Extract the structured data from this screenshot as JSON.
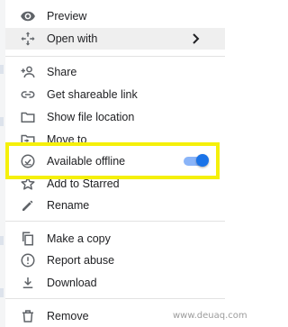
{
  "menu": {
    "items": [
      {
        "label": "Preview",
        "icon": "eye-icon"
      },
      {
        "label": "Open with",
        "icon": "move-arrows-icon",
        "submenu_indicator": "chevron-right-icon"
      },
      {
        "label": "Share",
        "icon": "person-add-icon"
      },
      {
        "label": "Get shareable link",
        "icon": "link-icon"
      },
      {
        "label": "Show file location",
        "icon": "folder-icon"
      },
      {
        "label": "Move to",
        "icon": "folder-move-icon"
      },
      {
        "label": "Available offline",
        "icon": "offline-check-icon",
        "toggle": true
      },
      {
        "label": "Add to Starred",
        "icon": "star-icon"
      },
      {
        "label": "Rename",
        "icon": "pencil-icon"
      },
      {
        "label": "Make a copy",
        "icon": "copy-icon"
      },
      {
        "label": "Report abuse",
        "icon": "alert-icon"
      },
      {
        "label": "Download",
        "icon": "download-icon"
      },
      {
        "label": "Remove",
        "icon": "trash-icon"
      }
    ]
  },
  "toggle_on": true,
  "colors": {
    "highlight_border": "#f5f00a",
    "toggle_knob": "#1a73e8",
    "toggle_track": "#8ab4f8",
    "hover_row": "#efefef"
  },
  "watermark": "www.deuaq.com"
}
